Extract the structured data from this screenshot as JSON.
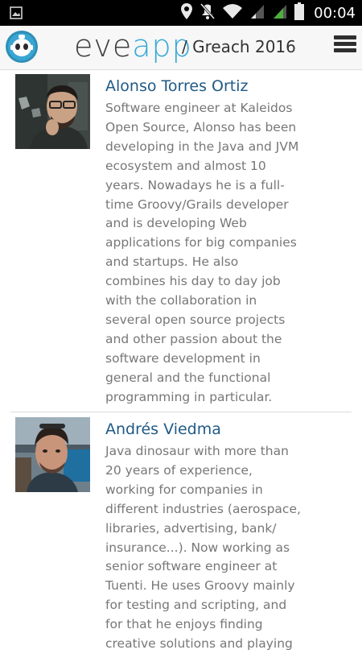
{
  "status_bar": {
    "time": "00:04",
    "icons": [
      "image-icon",
      "location-icon",
      "mute-icon",
      "wifi-icon",
      "signal-icon",
      "signal-icon",
      "battery-icon"
    ]
  },
  "header": {
    "brand_part1": "eve",
    "brand_part2": "app",
    "event_title": "/ Greach 2016",
    "colors": {
      "brand_dark": "#3e3e3e",
      "brand_accent": "#35a9d6"
    }
  },
  "speakers": [
    {
      "name": "Alonso Torres Ortiz",
      "bio_lines": [
        "Software engineer at Kaleidos",
        "Open Source, Alonso has been",
        "developing in the Java and JVM",
        "ecosystem and almost 10",
        "years. Nowadays he is a full-",
        "time Groovy/Grails developer",
        "and is developing Web",
        "applications for big companies",
        "and startups. He also",
        "combines his day to day job",
        "with the collaboration in",
        "several open source projects",
        "and other passion about the",
        "software development in",
        "general and the functional",
        "programming in particular."
      ]
    },
    {
      "name": "Andrés Viedma",
      "bio_lines": [
        "Java dinosaur with more than",
        "20 years of experience,",
        "working for companies in",
        "different industries (aerospace,",
        "libraries, advertising, bank/",
        "insurance...). Now working as",
        "senior software engineer at",
        "Tuenti. He uses Groovy mainly",
        "for testing and scripting, and",
        "for that he enjoys finding",
        "creative solutions and playing"
      ]
    }
  ],
  "colors": {
    "name_link": "#205a86",
    "bio_text": "#777777"
  }
}
